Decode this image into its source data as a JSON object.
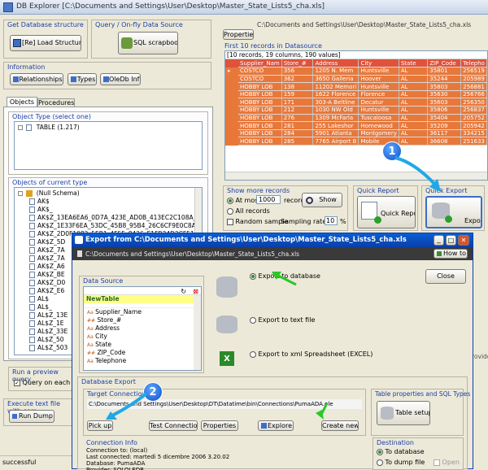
{
  "app": {
    "title": "DB Explorer [C:\\Documents and Settings\\User\\Desktop\\Master_State_Lists5_cha.xls]"
  },
  "left": {
    "db_structure": {
      "label": "Get Database structure",
      "button": "[Re] Load Structure"
    },
    "query": {
      "label": "Query / On-fly Data Source",
      "button": "SQL scrapbook"
    },
    "information": {
      "label": "Information",
      "buttons": [
        "Relationships",
        "Types",
        "OleDb Info"
      ]
    },
    "tabs": [
      "Objects",
      "Procedures"
    ],
    "object_type": {
      "label": "Object Type (select one)",
      "item": "TABLE (1.217)"
    },
    "objects": {
      "label": "Objects of current type",
      "root": "(Null Schema)",
      "items": [
        "AK$",
        "AK$_",
        "AK$Z_13EA6EA6_0D7A_423E_AD0B_413EC2C108A_#wvu",
        "AK$Z_1E33F6EA_53DC_45B8_95B4_26C6CF9E0C8A_#wvu",
        "AK$Z_2D0F1082_5EB1_4F55_8426_E1FB34D2CF51_#wvu",
        "AK$Z_5D",
        "AK$Z_7A",
        "AK$Z_7A",
        "AK$Z_A6",
        "AK$Z_BE",
        "AK$Z_D0",
        "AK$Z_E6",
        "AL$",
        "AL$_",
        "AL$Z_13E",
        "AL$Z_1E",
        "AL$Z_33E",
        "AL$Z_50",
        "AL$Z_503"
      ]
    },
    "preview": {
      "label": "Run a preview query",
      "checkbox": "Query on each sele"
    },
    "execute": {
      "label": "Execute text file with com",
      "button": "Run Dump"
    }
  },
  "right": {
    "properties_button": "Properties",
    "path": "C:\\Documents and Settings\\User\\Desktop\\Master_State_Lists5_cha.xls",
    "datasource_label": "First 10 records in Datasource",
    "summary": "[10 records, 19 columns, 190 values]",
    "columns": [
      "Supplier_Nam",
      "Store_#",
      "Address",
      "City",
      "State",
      "ZIP_Code",
      "Telepho"
    ],
    "rows": [
      [
        "COSTCO",
        "356",
        "1205 N. Mem",
        "Huntsville",
        "AL",
        "35801",
        "256519"
      ],
      [
        "COSTCO",
        "362",
        "3650 Galleria",
        "Hoover",
        "AL",
        "35244",
        "205989"
      ],
      [
        "HOBBY LOB",
        "138",
        "11202 Memori",
        "Huntsville",
        "AL",
        "35803",
        "256881"
      ],
      [
        "HOBBY LOB",
        "159",
        "1622 Florence",
        "Florence",
        "AL",
        "35630",
        "256766"
      ],
      [
        "HOBBY LOB",
        "171",
        "303-A Beltline",
        "Decatur",
        "AL",
        "35603",
        "256350"
      ],
      [
        "HOBBY LOB",
        "212",
        "1030 NW Old",
        "Huntsville",
        "AL",
        "35806",
        "256837"
      ],
      [
        "HOBBY LOB",
        "276",
        "1309 McFarla",
        "Tuscaloosa",
        "AL",
        "35404",
        "205752"
      ],
      [
        "HOBBY LOB",
        "281",
        "255 Lakeshor",
        "Homewood",
        "AL",
        "35209",
        "205942"
      ],
      [
        "HOBBY LOB",
        "284",
        "5901 Atlanta",
        "Montgomery",
        "AL",
        "36117",
        "334215"
      ],
      [
        "HOBBY LOB",
        "285",
        "7765 Airport B",
        "Mobile",
        "AL",
        "36608",
        "251633"
      ]
    ],
    "show_more": {
      "label": "Show more records",
      "at_most": "At most",
      "at_most_value": "1000",
      "records": "records",
      "all_records": "All records",
      "random": "Random sample",
      "sampling": "Sampling rate:",
      "sampling_value": "10",
      "percent": "%",
      "show_button": "Show"
    },
    "quick_report": {
      "label": "Quick Report",
      "button": "Quick Report"
    },
    "quick_export": {
      "label": "Quick Export",
      "button": "Export"
    }
  },
  "dialog": {
    "title": "Export from C:\\Documents and Settings\\User\\Desktop\\Master_State_Lists5_cha.xls",
    "path": "C:\\Documents and Settings\\User\\Desktop\\Master_State_Lists5_cha.xls",
    "howto": "How to",
    "datasource_label": "Data Source",
    "table_name": "NewTable",
    "fields": [
      "Supplier_Name",
      "Store_#",
      "Address",
      "City",
      "State",
      "ZIP_Code",
      "Telephone"
    ],
    "options": [
      "Export to database",
      "Export to text file",
      "Export to xml Spreadsheet (EXCEL)"
    ],
    "close": "Close",
    "db_export_label": "Database Export",
    "target_label": "Target Connection",
    "target_path": "C:\\Documents and Settings\\User\\Desktop\\DT\\Datatime\\bin\\Connections\\PumaADA.ole",
    "buttons": [
      "Pick up",
      "Test Connection",
      "Properties",
      "Explore",
      "Create new"
    ],
    "table_props_label": "Table properties and SQL Types",
    "table_setup": "Table setup",
    "conn_info_label": "Connection Info",
    "conn_info": [
      "Connection to: (local)",
      "Last connected: martedì 5 dicembre 2006 3.20.02",
      "Database: PumaADA",
      "Provider: SQLOLEDB"
    ],
    "destination_label": "Destination",
    "dest_db": "To database",
    "dest_file": "To dump file",
    "open": "Open"
  },
  "status": {
    "text": "successful"
  },
  "badges": [
    "1",
    "2"
  ],
  "behind": {
    "provider": "rovider"
  }
}
